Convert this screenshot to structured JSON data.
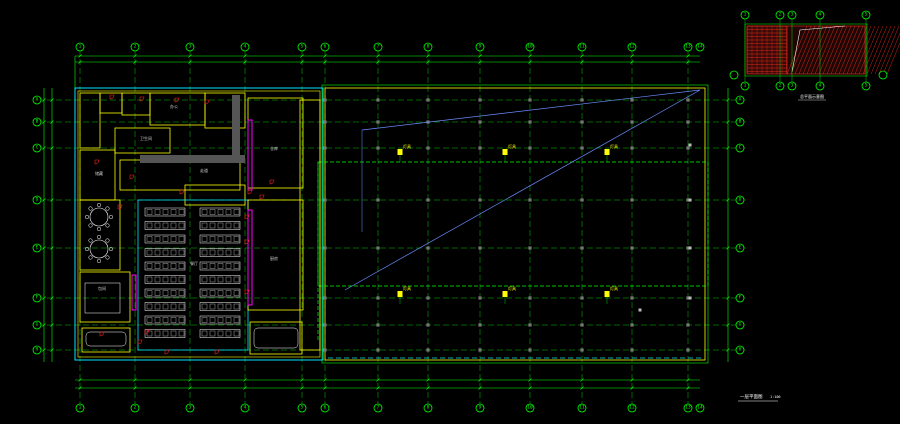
{
  "drawing": {
    "top_grid": [
      "1",
      "2",
      "3",
      "4",
      "5",
      "6",
      "7",
      "8",
      "9",
      "10",
      "11",
      "12",
      "13",
      "14",
      "15"
    ],
    "left_grid": [
      "A",
      "B",
      "C",
      "D",
      "E",
      "F",
      "G",
      "H"
    ],
    "right_grid": [
      "A",
      "B",
      "C",
      "D",
      "E",
      "F",
      "G",
      "H"
    ],
    "inset_grid_top": [
      "1",
      "2",
      "3",
      "4",
      "5"
    ],
    "inset_grid_bottom": [
      "1",
      "2",
      "3",
      "4",
      "5"
    ],
    "inset_title": "总平面示意图",
    "main_title": "一层平面图",
    "main_scale": "1:100",
    "colors": {
      "background": "#000000",
      "grid": "#00ff00",
      "wall_yellow": "#ffff00",
      "wall_cyan": "#00e5ff",
      "wall_magenta": "#ff00ff",
      "door_red": "#ff2020",
      "text": "#ffffff",
      "hatch": "#ff3020",
      "leader_blue": "#6a8cff"
    },
    "room_labels": [
      "餐厅",
      "厨房",
      "仓库",
      "办公",
      "储藏",
      "包间",
      "卫生间",
      "走道"
    ],
    "lamp_tags": [
      "灯具",
      "灯具",
      "灯具",
      "灯具",
      "灯具",
      "灯具"
    ]
  }
}
